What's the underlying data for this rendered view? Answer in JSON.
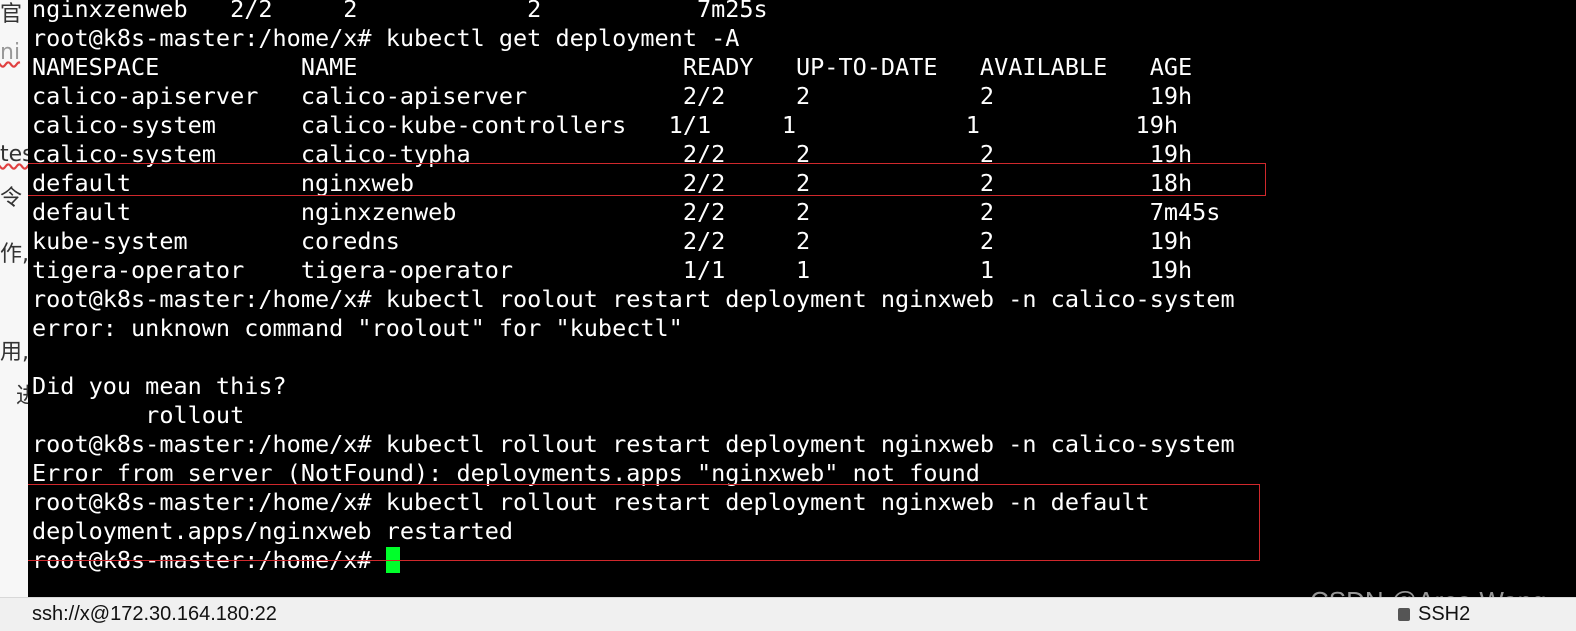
{
  "background_fragments": [
    "官",
    "ni",
    "tes",
    "令",
    "作,",
    "用,",
    "进"
  ],
  "terminal": {
    "lines": [
      "nginxzenweb   2/2     2            2           7m25s",
      "root@k8s-master:/home/x# kubectl get deployment -A",
      "NAMESPACE          NAME                       READY   UP-TO-DATE   AVAILABLE   AGE",
      "calico-apiserver   calico-apiserver           2/2     2            2           19h",
      "calico-system      calico-kube-controllers   1/1     1            1           19h",
      "calico-system      calico-typha               2/2     2            2           19h",
      "default            nginxweb                   2/2     2            2           18h",
      "default            nginxzenweb                2/2     2            2           7m45s",
      "kube-system        coredns                    2/2     2            2           19h",
      "tigera-operator    tigera-operator            1/1     1            1           19h",
      "root@k8s-master:/home/x# kubectl roolout restart deployment nginxweb -n calico-system",
      "error: unknown command \"roolout\" for \"kubectl\"",
      "",
      "Did you mean this?",
      "        rollout",
      "root@k8s-master:/home/x# kubectl rollout restart deployment nginxweb -n calico-system",
      "Error from server (NotFound): deployments.apps \"nginxweb\" not found",
      "root@k8s-master:/home/x# kubectl rollout restart deployment nginxweb -n default",
      "deployment.apps/nginxweb restarted",
      "root@k8s-master:/home/x# "
    ],
    "cursor_color": "#00ff2a",
    "highlight_color": "#d0282c"
  },
  "statusbar": {
    "connection": "ssh://x@172.30.164.180:22",
    "protocol": "SSH2"
  },
  "watermark": "CSDN @Ares-Wang"
}
